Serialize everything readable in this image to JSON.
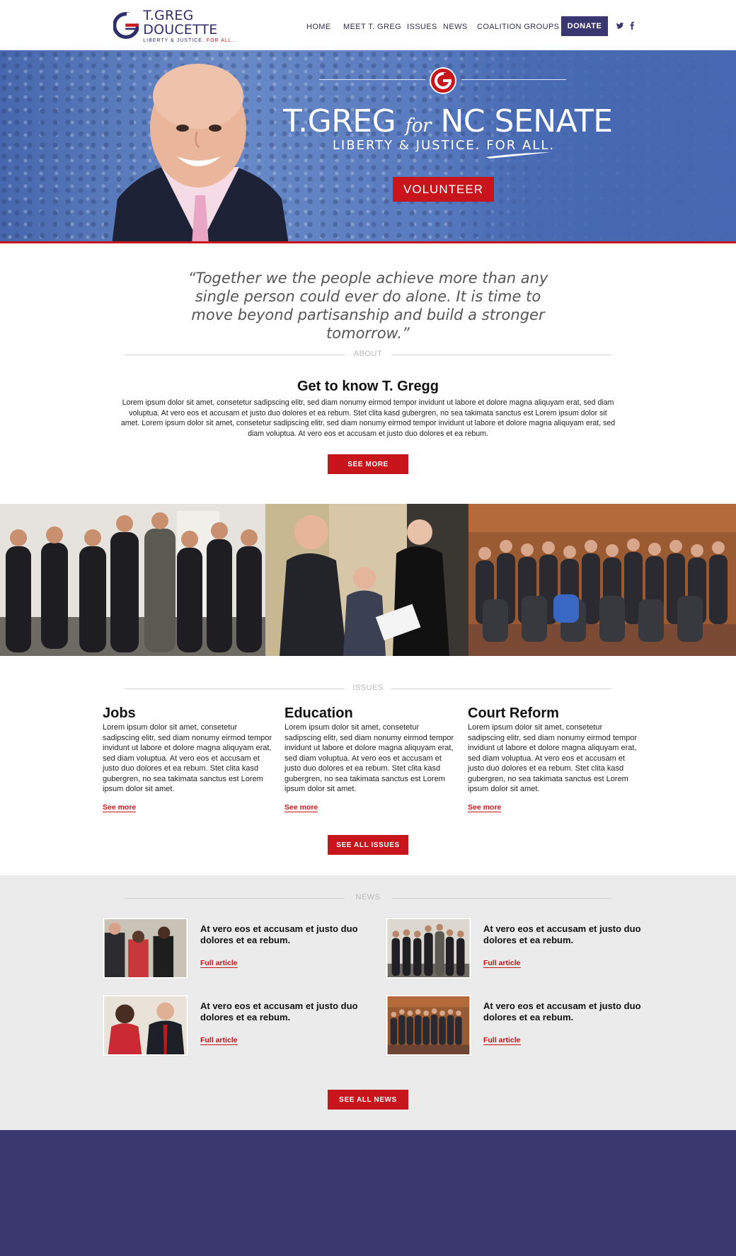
{
  "header": {
    "logo_name": "T.GREG DOUCETTE",
    "logo_tagline_a": "LIBERTY & JUSTICE.",
    "logo_tagline_b": "FOR ALL.",
    "nav": [
      "HOME",
      "MEET T. GREG",
      "ISSUES",
      "NEWS",
      "COALITION GROUPS"
    ],
    "donate_label": "DONATE",
    "social_icons": [
      "twitter-icon",
      "facebook-icon"
    ]
  },
  "hero": {
    "title_a": "T.GREG",
    "title_for": "for",
    "title_b": "NC SENATE",
    "subtitle": "LIBERTY & JUSTICE. FOR ALL.",
    "cta_label": "VOLUNTEER"
  },
  "quote": "“Together we the people achieve more than any single person could ever do alone. It is time to move beyond partisanship and build a stronger tomorrow.”",
  "about": {
    "section_label": "ABOUT",
    "title": "Get to know T. Gregg",
    "body": "Lorem ipsum dolor sit amet, consetetur sadipscing elitr, sed diam nonumy eirmod tempor invidunt ut labore et dolore magna aliquyam erat, sed diam voluptua. At vero eos et accusam et justo duo dolores et ea rebum. Stet clita kasd gubergren, no sea takimata sanctus est Lorem ipsum dolor sit amet. Lorem ipsum dolor sit amet, consetetur sadipscing elitr, sed diam nonumy eirmod tempor invidunt ut labore et dolore magna aliquyam erat, sed diam voluptua. At vero eos et accusam et justo duo dolores et ea rebum.",
    "button_label": "SEE MORE"
  },
  "issues": {
    "section_label": "ISSUES",
    "items": [
      {
        "title": "Jobs",
        "body": "Lorem ipsum dolor sit amet, consetetur sadipscing elitr, sed diam nonumy eirmod tempor invidunt ut labore et dolore magna aliquyam erat, sed diam voluptua. At vero eos et accusam et justo duo dolores et ea rebum. Stet clita kasd gubergren, no sea takimata sanctus est Lorem ipsum dolor sit amet.",
        "link": "See more"
      },
      {
        "title": "Education",
        "body": "Lorem ipsum dolor sit amet, consetetur sadipscing elitr, sed diam nonumy eirmod tempor invidunt ut labore et dolore magna aliquyam erat, sed diam voluptua. At vero eos et accusam et justo duo dolores et ea rebum. Stet clita kasd gubergren, no sea takimata sanctus est Lorem ipsum dolor sit amet.",
        "link": "See more"
      },
      {
        "title": "Court Reform",
        "body": "Lorem ipsum dolor sit amet, consetetur sadipscing elitr, sed diam nonumy eirmod tempor invidunt ut labore et dolore magna aliquyam erat, sed diam voluptua. At vero eos et accusam et justo duo dolores et ea rebum. Stet clita kasd gubergren, no sea takimata sanctus est Lorem ipsum dolor sit amet.",
        "link": "See more"
      }
    ],
    "button_label": "SEE ALL ISSUES"
  },
  "news": {
    "section_label": "NEWS",
    "items": [
      {
        "title": "At vero eos et accusam et justo duo dolores et ea rebum.",
        "link": "Full article"
      },
      {
        "title": "At vero eos et accusam et justo duo dolores et ea rebum.",
        "link": "Full article"
      },
      {
        "title": "At vero eos et accusam et justo duo dolores et ea rebum.",
        "link": "Full article"
      },
      {
        "title": "At vero eos et accusam et justo duo dolores et ea rebum.",
        "link": "Full article"
      }
    ],
    "button_label": "SEE ALL NEWS"
  },
  "colors": {
    "brand_navy": "#3b3870",
    "brand_red": "#c8141b",
    "hero_blue": "#4a6db7",
    "news_bg": "#ebebeb"
  }
}
